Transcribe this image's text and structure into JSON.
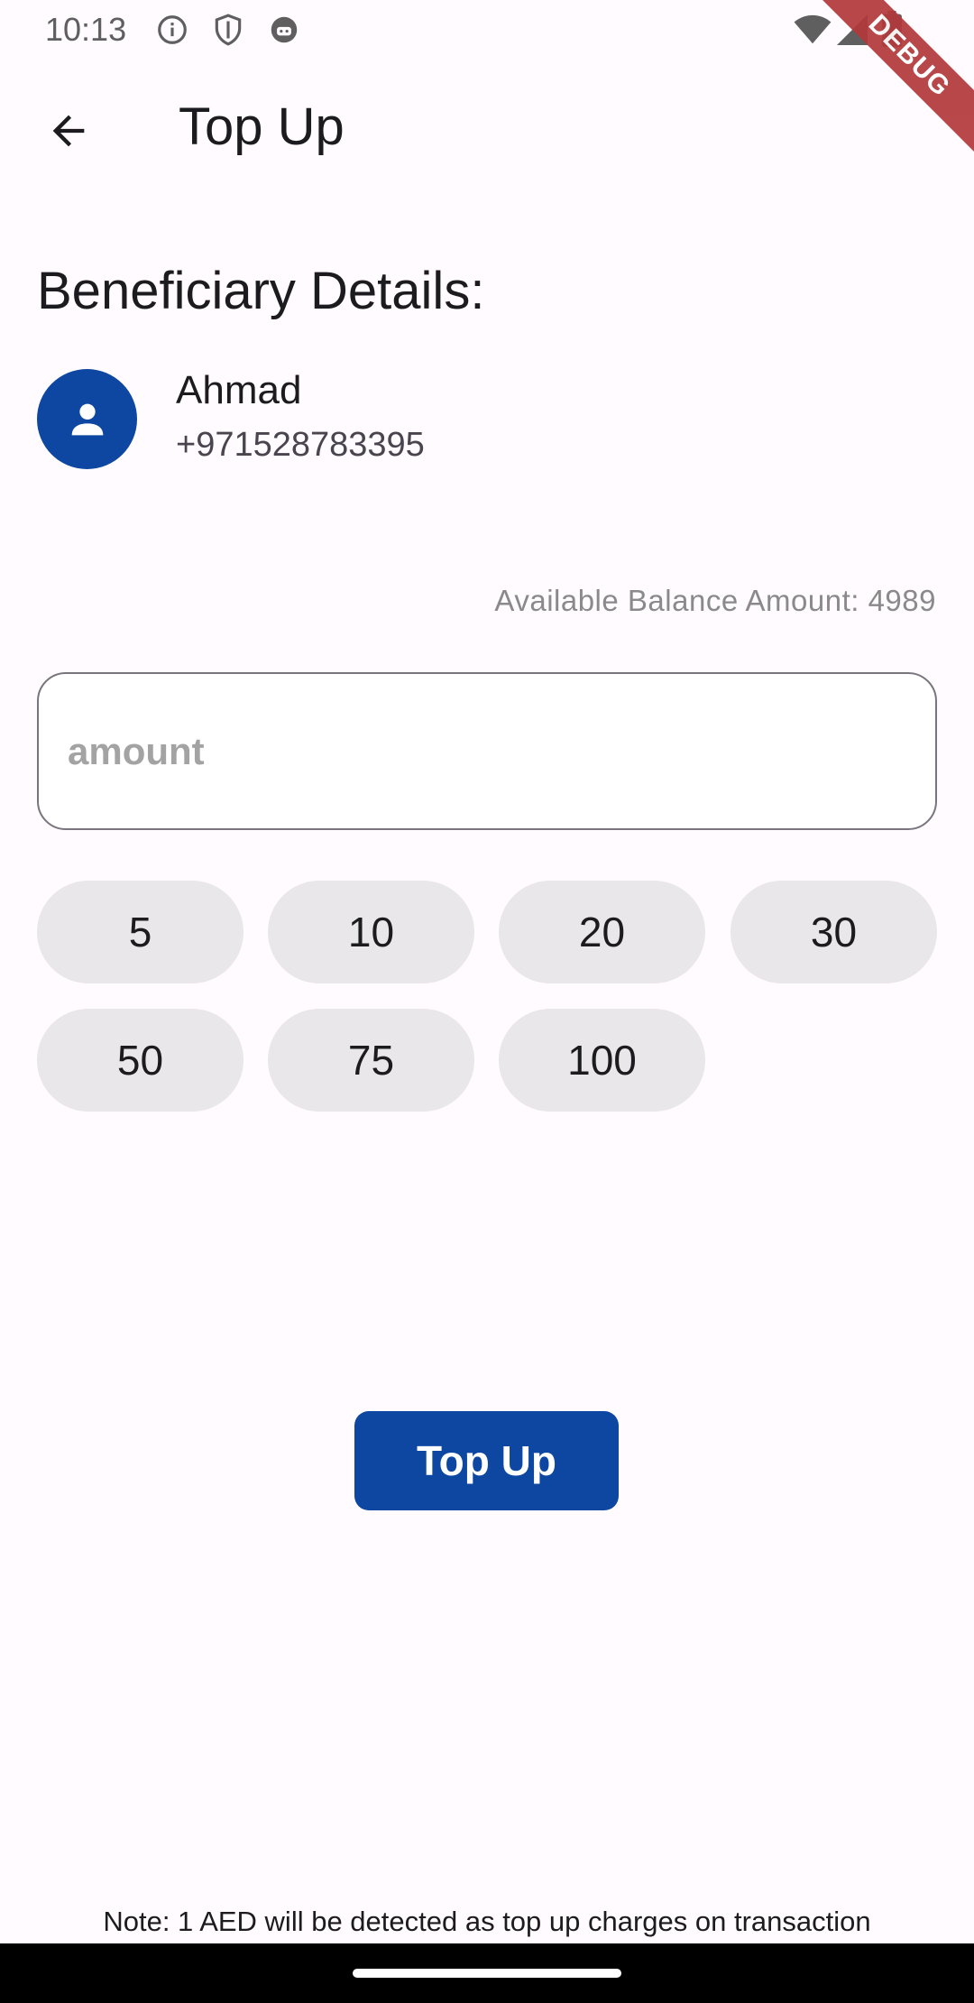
{
  "status_bar": {
    "time": "10:13",
    "icons": [
      "info-icon",
      "shield-icon",
      "android-icon",
      "wifi-icon",
      "signal-icon",
      "battery-icon"
    ]
  },
  "debug_banner": "DEBUG",
  "app_bar": {
    "title": "Top Up",
    "back_icon": "arrow-back-icon"
  },
  "beneficiary": {
    "section_title": "Beneficiary Details:",
    "name": "Ahmad",
    "phone": "+971528783395",
    "avatar_icon": "person-icon"
  },
  "balance_text": "Available Balance Amount: 4989",
  "amount_input": {
    "placeholder": "amount",
    "value": ""
  },
  "quick_amounts": [
    "5",
    "10",
    "20",
    "30",
    "50",
    "75",
    "100"
  ],
  "submit_label": "Top Up",
  "note": "Note: 1 AED will be detected as top up charges on transaction",
  "colors": {
    "primary": "#0d47a1",
    "background": "#fffbfe",
    "chip": "#e9e7e9",
    "debug_ribbon": "#b3383b"
  }
}
